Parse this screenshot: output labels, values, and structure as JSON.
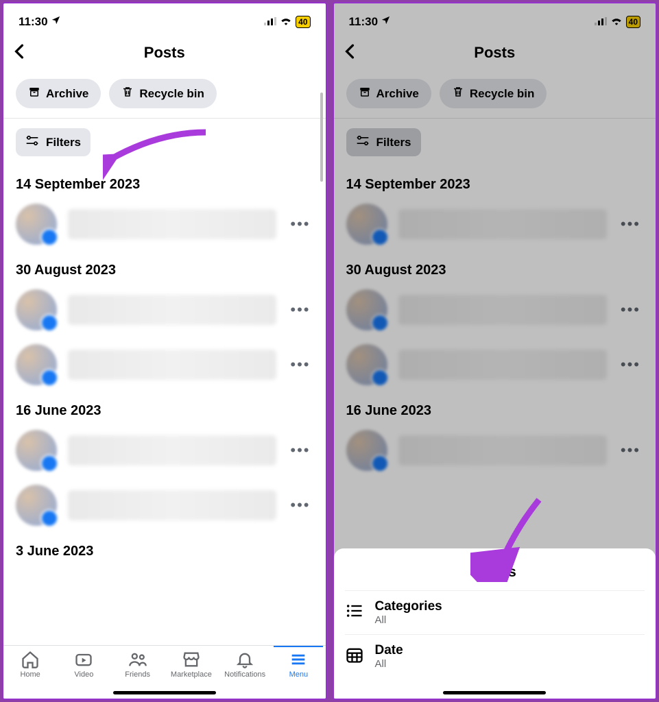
{
  "statusbar": {
    "time": "11:30",
    "battery": "40"
  },
  "header": {
    "title": "Posts"
  },
  "chips": {
    "archive": "Archive",
    "recycle": "Recycle bin"
  },
  "filters": {
    "label": "Filters"
  },
  "dates": {
    "d1": "14 September 2023",
    "d2": "30 August 2023",
    "d3": "16 June 2023",
    "d4": "3 June 2023"
  },
  "tabs": {
    "home": "Home",
    "video": "Video",
    "friends": "Friends",
    "marketplace": "Marketplace",
    "notifications": "Notifications",
    "menu": "Menu"
  },
  "sheet": {
    "title": "Filters",
    "categories": {
      "label": "Categories",
      "value": "All"
    },
    "date": {
      "label": "Date",
      "value": "All"
    }
  }
}
